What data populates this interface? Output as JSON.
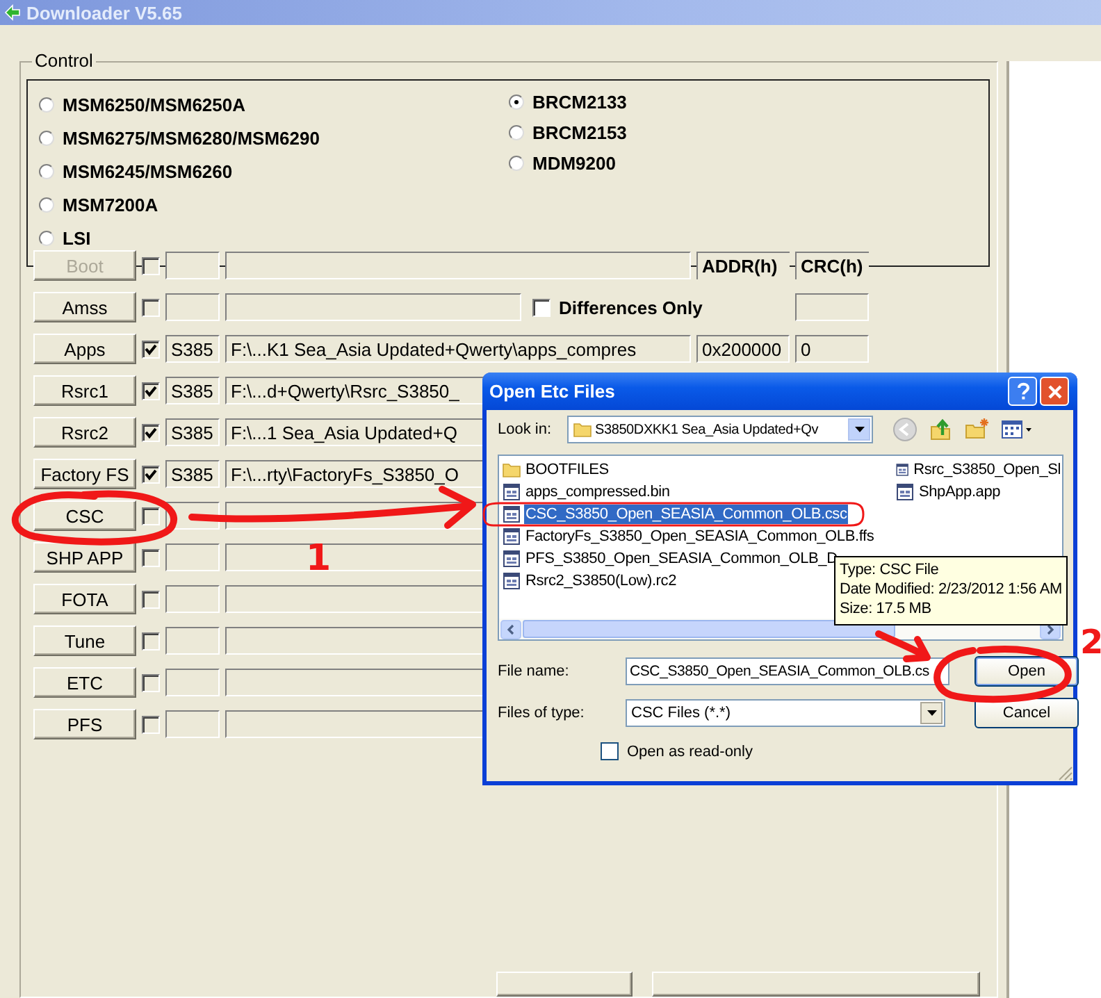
{
  "window": {
    "title": "Downloader V5.65"
  },
  "control": {
    "legend": "Control",
    "columns": [
      {
        "options": [
          {
            "label": "MSM6250/MSM6250A",
            "selected": false
          },
          {
            "label": "MSM6275/MSM6280/MSM6290",
            "selected": false
          },
          {
            "label": "MSM6245/MSM6260",
            "selected": false
          },
          {
            "label": "MSM7200A",
            "selected": false
          },
          {
            "label": "LSI",
            "selected": false
          }
        ]
      },
      {
        "options": [
          {
            "label": "BRCM2133",
            "selected": true
          },
          {
            "label": "BRCM2153",
            "selected": false
          },
          {
            "label": "MDM9200",
            "selected": false
          }
        ]
      }
    ]
  },
  "rows": [
    {
      "kind": "header",
      "label": "Boot",
      "disabled": true,
      "checked": false,
      "addr_heading": "ADDR(h)",
      "crc_heading": "CRC(h)"
    },
    {
      "kind": "option",
      "label": "Amss",
      "disabled": false,
      "checked": false,
      "option": {
        "label": "Differences Only",
        "checked": false
      }
    },
    {
      "kind": "file",
      "label": "Apps",
      "disabled": false,
      "checked": true,
      "code": "S385",
      "path": "F:\\...K1 Sea_Asia Updated+Qwerty\\apps_compres",
      "addr": "0x200000",
      "crc": "0"
    },
    {
      "kind": "file",
      "label": "Rsrc1",
      "disabled": false,
      "checked": true,
      "code": "S385",
      "path": "F:\\...d+Qwerty\\Rsrc_S3850_"
    },
    {
      "kind": "file",
      "label": "Rsrc2",
      "disabled": false,
      "checked": true,
      "code": "S385",
      "path": "F:\\...1 Sea_Asia Updated+Q"
    },
    {
      "kind": "file",
      "label": "Factory FS",
      "disabled": false,
      "checked": true,
      "code": "S385",
      "path": "F:\\...rty\\FactoryFs_S3850_O"
    },
    {
      "kind": "file",
      "label": "CSC",
      "disabled": false,
      "checked": false
    },
    {
      "kind": "file",
      "label": "SHP APP",
      "disabled": false,
      "checked": false
    },
    {
      "kind": "file",
      "label": "FOTA",
      "disabled": false,
      "checked": false
    },
    {
      "kind": "file",
      "label": "Tune",
      "disabled": false,
      "checked": false
    },
    {
      "kind": "file",
      "label": "ETC",
      "disabled": false,
      "checked": false
    },
    {
      "kind": "file",
      "label": "PFS",
      "disabled": false,
      "checked": false
    }
  ],
  "dialog": {
    "title": "Open Etc Files",
    "look_in_label": "Look in:",
    "look_in": "S3850DXKK1 Sea_Asia Updated+Qv",
    "files": [
      {
        "name": "BOOTFILES",
        "kind": "folder",
        "selected": false
      },
      {
        "name": "apps_compressed.bin",
        "kind": "file",
        "selected": false
      },
      {
        "name": "CSC_S3850_Open_SEASIA_Common_OLB.csc",
        "kind": "file",
        "selected": true
      },
      {
        "name": "FactoryFs_S3850_Open_SEASIA_Common_OLB.ffs",
        "kind": "file",
        "selected": false
      },
      {
        "name": "PFS_S3850_Open_SEASIA_Common_OLB_D",
        "kind": "file",
        "selected": false
      },
      {
        "name": "Rsrc2_S3850(Low).rc2",
        "kind": "file",
        "selected": false
      },
      {
        "name": "Rsrc_S3850_Open_Sl",
        "kind": "file",
        "selected": false
      },
      {
        "name": "ShpApp.app",
        "kind": "file",
        "selected": false
      }
    ],
    "tooltip": [
      "Type: CSC File",
      "Date Modified: 2/23/2012 1:56 AM",
      "Size: 17.5 MB"
    ],
    "file_name_label": "File name:",
    "file_name": "CSC_S3850_Open_SEASIA_Common_OLB.cs",
    "file_type_label": "Files of type:",
    "file_type": "CSC Files (*.*)",
    "open_button": "Open",
    "cancel_button": "Cancel",
    "read_only": {
      "label": "Open as read-only",
      "checked": false
    }
  },
  "annotations": {
    "step_numbers": [
      "1",
      "2"
    ]
  }
}
